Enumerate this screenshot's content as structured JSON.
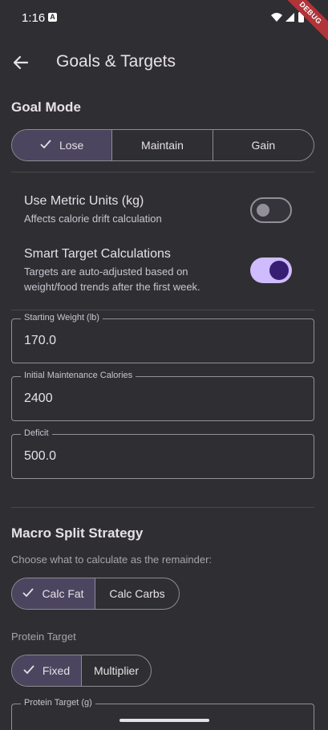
{
  "status_bar": {
    "time": "1:16",
    "badge": "A",
    "debug_label": "DEBUG"
  },
  "app_bar": {
    "title": "Goals & Targets",
    "back_icon": "arrow-left"
  },
  "goal_mode": {
    "title": "Goal Mode",
    "options": [
      "Lose",
      "Maintain",
      "Gain"
    ],
    "selected": "Lose"
  },
  "metric_units": {
    "title": "Use Metric Units (kg)",
    "subtitle": "Affects calorie drift calculation",
    "enabled": false
  },
  "smart_targets": {
    "title": "Smart Target Calculations",
    "subtitle_line1": "Targets are auto-adjusted based on",
    "subtitle_line2": "weight/food trends after the first week.",
    "enabled": true
  },
  "fields": {
    "starting_weight": {
      "label": "Starting Weight (lb)",
      "value": "170.0"
    },
    "maintenance": {
      "label": "Initial Maintenance Calories",
      "value": "2400"
    },
    "deficit": {
      "label": "Deficit",
      "value": "500.0"
    },
    "protein_target": {
      "label": "Protein Target (g)",
      "value": ""
    }
  },
  "macro_split": {
    "title": "Macro Split Strategy",
    "subtitle": "Choose what to calculate as the remainder:",
    "options": [
      "Calc Fat",
      "Calc Carbs"
    ],
    "selected": "Calc Fat"
  },
  "protein_mode": {
    "label": "Protein Target",
    "options": [
      "Fixed",
      "Multiplier"
    ],
    "selected": "Fixed"
  },
  "colors": {
    "background": "#2f2f33",
    "accent": "#cfbcff",
    "selected_segment": "#4b4560",
    "outline": "#938f99"
  }
}
